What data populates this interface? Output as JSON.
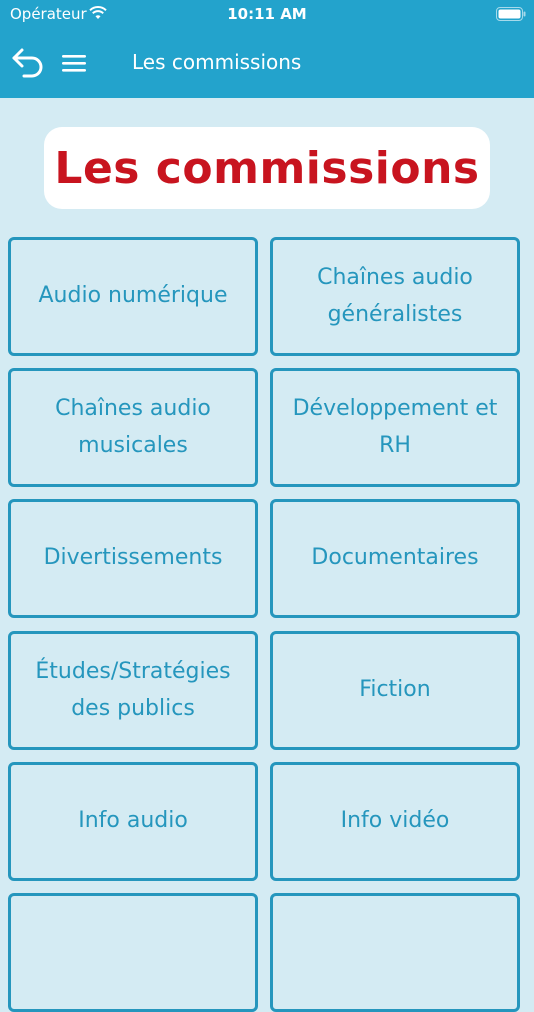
{
  "status_bar": {
    "carrier": "Opérateur",
    "time": "10:11 AM"
  },
  "nav": {
    "title": "Les commissions",
    "icons": {
      "back": "back-arrow-icon",
      "menu": "hamburger-menu-icon"
    }
  },
  "header": {
    "title": "Les commissions"
  },
  "colors": {
    "accent": "#23a3cc",
    "tile_border": "#2596bd",
    "title_red": "#c8141f",
    "background": "#d4ebf3"
  },
  "tiles": [
    {
      "label": "Audio numérique"
    },
    {
      "label": "Chaînes audio généralistes"
    },
    {
      "label": "Chaînes audio musicales"
    },
    {
      "label": "Développement et RH"
    },
    {
      "label": "Divertissements"
    },
    {
      "label": "Documentaires"
    },
    {
      "label": "Études/Stratégies des publics"
    },
    {
      "label": "Fiction"
    },
    {
      "label": "Info audio"
    },
    {
      "label": "Info vidéo"
    },
    {
      "label": ""
    },
    {
      "label": ""
    }
  ]
}
